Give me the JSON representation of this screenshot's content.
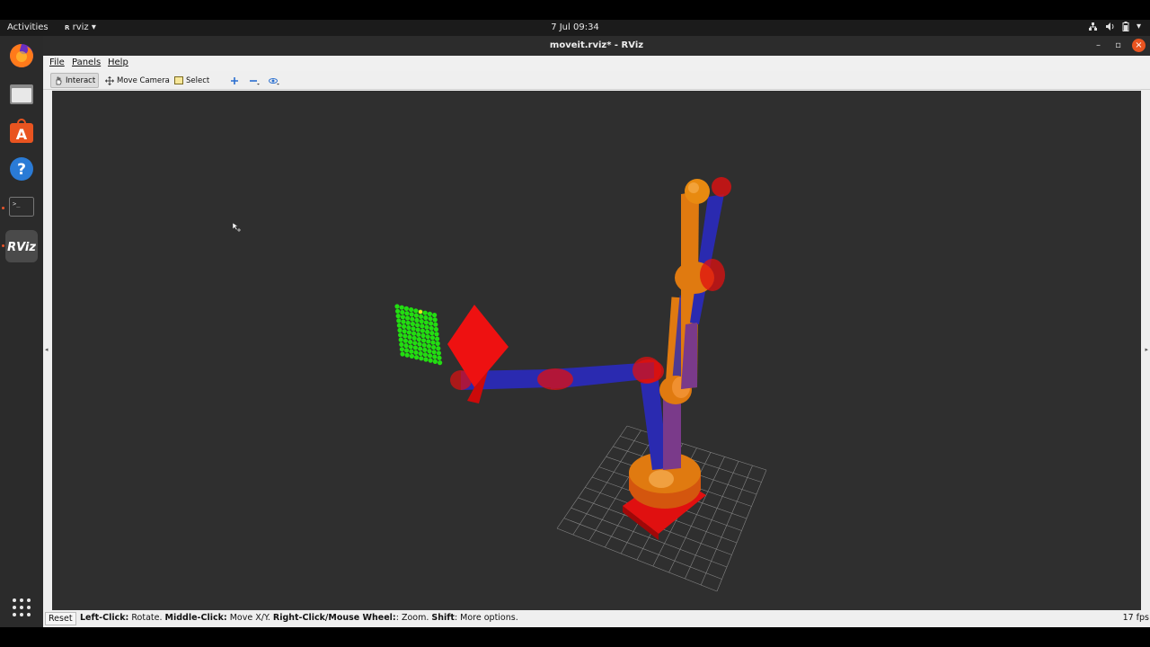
{
  "topbar": {
    "activities": "Activities",
    "app_menu": "rviz ▾",
    "clock": "7 Jul  09:34",
    "network_icon": "network-icon",
    "volume_icon": "volume-icon",
    "battery_icon": "battery-icon",
    "menu_arrow": "▾"
  },
  "dock": {
    "items": [
      {
        "name": "firefox",
        "icon": "firefox-icon"
      },
      {
        "name": "files",
        "icon": "folder-icon"
      },
      {
        "name": "software",
        "icon": "app-store-icon"
      },
      {
        "name": "help",
        "icon": "help-icon",
        "glyph": "?"
      },
      {
        "name": "terminal",
        "icon": "terminal-icon",
        "glyph": ">_"
      },
      {
        "name": "rviz",
        "icon": "rviz-icon",
        "glyph": "RViz"
      }
    ],
    "show_apps_icon": "apps-grid-icon"
  },
  "window": {
    "title": "moveit.rviz* - RViz",
    "minimize": "–",
    "maximize": "▫",
    "close": "×"
  },
  "menubar": {
    "file": "File",
    "panels": "Panels",
    "help": "Help"
  },
  "toolbar": {
    "interact": "Interact",
    "move_camera": "Move Camera",
    "select": "Select",
    "add_icon": "plus-icon",
    "remove_icon": "minus-icon",
    "view_icon": "eye-icon"
  },
  "statusbar": {
    "reset": "Reset",
    "left_click_label": "Left-Click:",
    "left_click_text": " Rotate. ",
    "middle_click_label": "Middle-Click:",
    "middle_click_text": " Move X/Y. ",
    "right_click_label": "Right-Click/Mouse Wheel:",
    "right_click_text": ": Zoom. ",
    "shift_label": "Shift",
    "shift_text": ": More options.",
    "fps": "17 fps"
  },
  "colors": {
    "viewport_bg": "#2f2f2f",
    "robot_orange": "#e07a10",
    "robot_blue": "#2a2ab0",
    "robot_red": "#e01010",
    "target_green": "#22dd11",
    "grid": "#9a9a9a"
  }
}
